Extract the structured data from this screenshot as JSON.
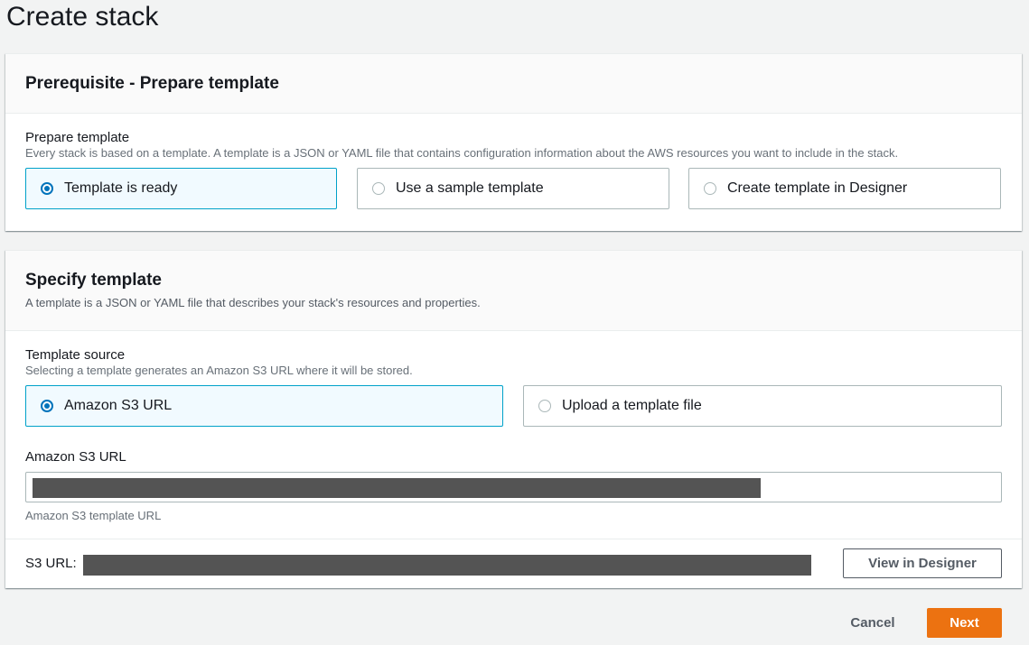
{
  "page": {
    "title": "Create stack"
  },
  "prerequisite": {
    "title": "Prerequisite - Prepare template",
    "field_label": "Prepare template",
    "field_desc": "Every stack is based on a template. A template is a JSON or YAML file that contains configuration information about the AWS resources you want to include in the stack.",
    "options": [
      {
        "label": "Template is ready",
        "selected": true
      },
      {
        "label": "Use a sample template",
        "selected": false
      },
      {
        "label": "Create template in Designer",
        "selected": false
      }
    ]
  },
  "specify": {
    "title": "Specify template",
    "desc": "A template is a JSON or YAML file that describes your stack's resources and properties.",
    "source_label": "Template source",
    "source_desc": "Selecting a template generates an Amazon S3 URL where it will be stored.",
    "options": [
      {
        "label": "Amazon S3 URL",
        "selected": true
      },
      {
        "label": "Upload a template file",
        "selected": false
      }
    ],
    "url_label": "Amazon S3 URL",
    "url_hint": "Amazon S3 template URL",
    "s3_url_label": "S3 URL:",
    "view_designer_label": "View in Designer"
  },
  "footer": {
    "cancel_label": "Cancel",
    "next_label": "Next"
  },
  "colors": {
    "accent": "#0073bb",
    "selected_border": "#00a1c9",
    "primary": "#ec7211"
  }
}
